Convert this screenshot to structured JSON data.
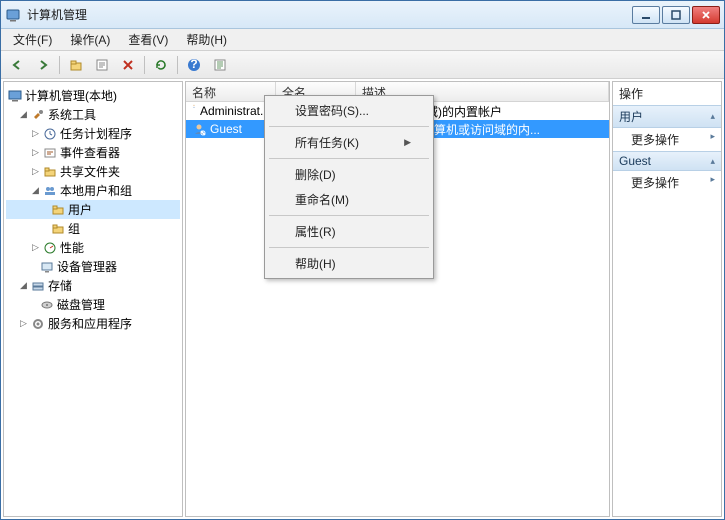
{
  "window": {
    "title": "计算机管理"
  },
  "menu": {
    "file": "文件(F)",
    "action": "操作(A)",
    "view": "查看(V)",
    "help": "帮助(H)"
  },
  "tree": {
    "root": "计算机管理(本地)",
    "system_tools": "系统工具",
    "task_scheduler": "任务计划程序",
    "event_viewer": "事件查看器",
    "shared_folders": "共享文件夹",
    "local_users_groups": "本地用户和组",
    "users": "用户",
    "groups": "组",
    "performance": "性能",
    "device_manager": "设备管理器",
    "storage": "存储",
    "disk_management": "磁盘管理",
    "services_apps": "服务和应用程序"
  },
  "columns": {
    "name": "名称",
    "fullname": "全名",
    "description": "描述"
  },
  "rows": {
    "admin": {
      "name": "Administrat...",
      "fullname": "",
      "desc": "管理计算机(域)的内置帐户"
    },
    "guest": {
      "name": "Guest",
      "fullname": "",
      "desc": "供来宾访问计算机或访问域的内..."
    }
  },
  "context_menu": {
    "set_password": "设置密码(S)...",
    "all_tasks": "所有任务(K)",
    "delete": "删除(D)",
    "rename": "重命名(M)",
    "properties": "属性(R)",
    "help": "帮助(H)"
  },
  "actions": {
    "header": "操作",
    "section_users": "用户",
    "more_actions": "更多操作",
    "section_guest": "Guest"
  }
}
